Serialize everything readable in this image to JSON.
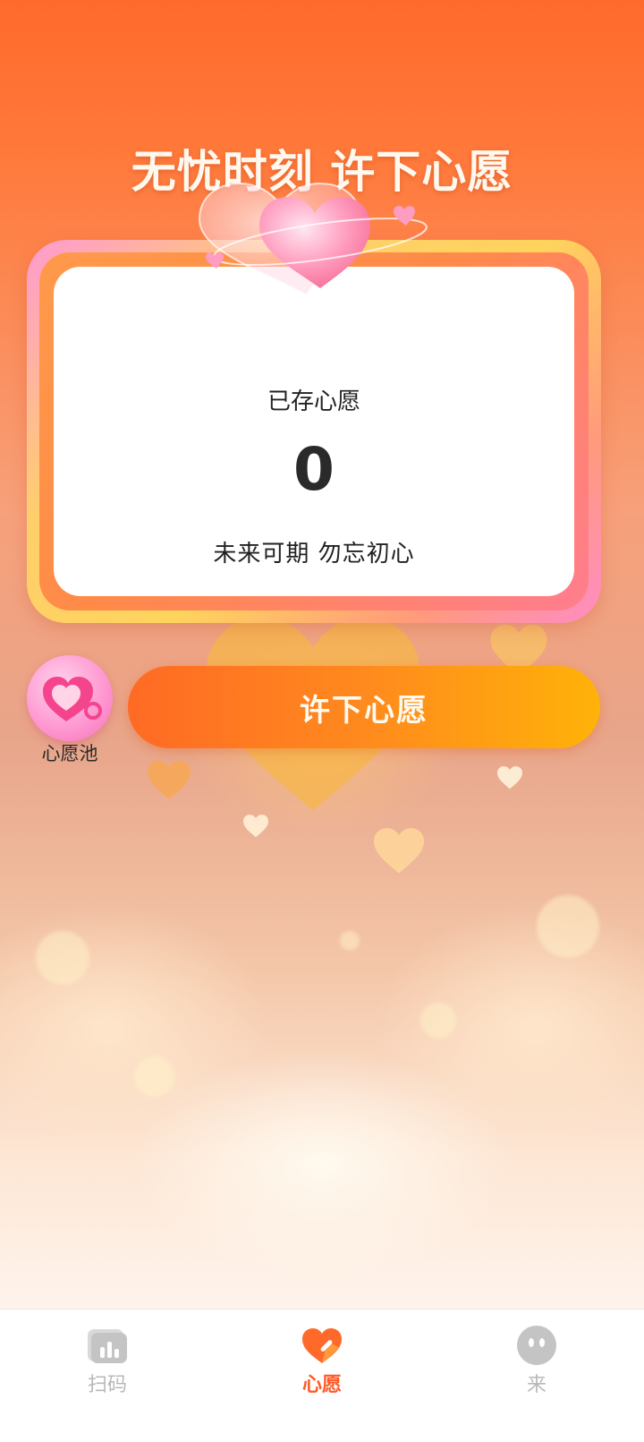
{
  "header": {
    "title": "无忧时刻 许下心愿"
  },
  "card": {
    "label": "已存心愿",
    "count": "0",
    "slogan": "未来可期  勿忘初心"
  },
  "actions": {
    "pool_label": "心愿池",
    "wish_button": "许下心愿"
  },
  "tabbar": {
    "items": [
      {
        "label": "扫码",
        "icon": "chart-icon",
        "active": false
      },
      {
        "label": "心愿",
        "icon": "heart-pen-icon",
        "active": true
      },
      {
        "label": "来",
        "icon": "face-icon",
        "active": false
      }
    ]
  },
  "colors": {
    "accent": "#ff6a24",
    "active_tab": "#ff5a28",
    "inactive_tab": "#b8b8b8"
  }
}
